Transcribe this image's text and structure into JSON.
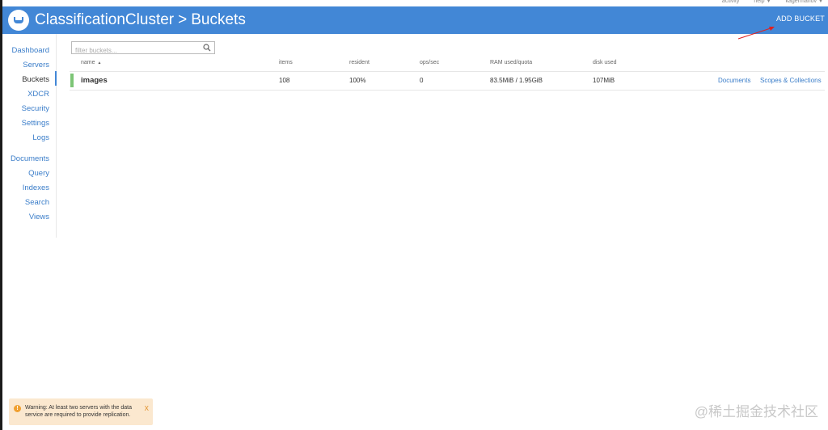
{
  "top_links": {
    "activity": "activity",
    "help": "help",
    "user": "kagermanov"
  },
  "header": {
    "title_cluster": "ClassificationCluster",
    "title_separator": ">",
    "title_page": "Buckets",
    "add_bucket": "ADD BUCKET"
  },
  "nav": {
    "items": [
      {
        "label": "Dashboard"
      },
      {
        "label": "Servers"
      },
      {
        "label": "Buckets"
      },
      {
        "label": "XDCR"
      },
      {
        "label": "Security"
      },
      {
        "label": "Settings"
      },
      {
        "label": "Logs"
      },
      {
        "label": "Documents"
      },
      {
        "label": "Query"
      },
      {
        "label": "Indexes"
      },
      {
        "label": "Search"
      },
      {
        "label": "Views"
      }
    ],
    "active": "Buckets"
  },
  "filter": {
    "placeholder": "filter buckets..."
  },
  "table": {
    "columns": [
      "name",
      "items",
      "resident",
      "ops/sec",
      "RAM used/quota",
      "disk used"
    ],
    "sort_indicator": "▲",
    "rows": [
      {
        "name": "images",
        "items": "108",
        "resident": "100%",
        "ops": "0",
        "ram": "83.5MiB / 1.95GiB",
        "disk": "107MiB",
        "link_documents": "Documents",
        "link_scopes": "Scopes & Collections",
        "status_color": "#7cc576"
      }
    ]
  },
  "warning": {
    "text": "Warning: At least two servers with the data service are required to provide replication.",
    "close": "X",
    "icon": "exclamation-icon"
  },
  "watermark": "@稀土掘金技术社区",
  "colors": {
    "header": "#4287d6",
    "link": "#3a7dc9",
    "healthy": "#7cc576",
    "warning_bg": "#fbe8cf",
    "annotation_arrow": "#e02020"
  }
}
